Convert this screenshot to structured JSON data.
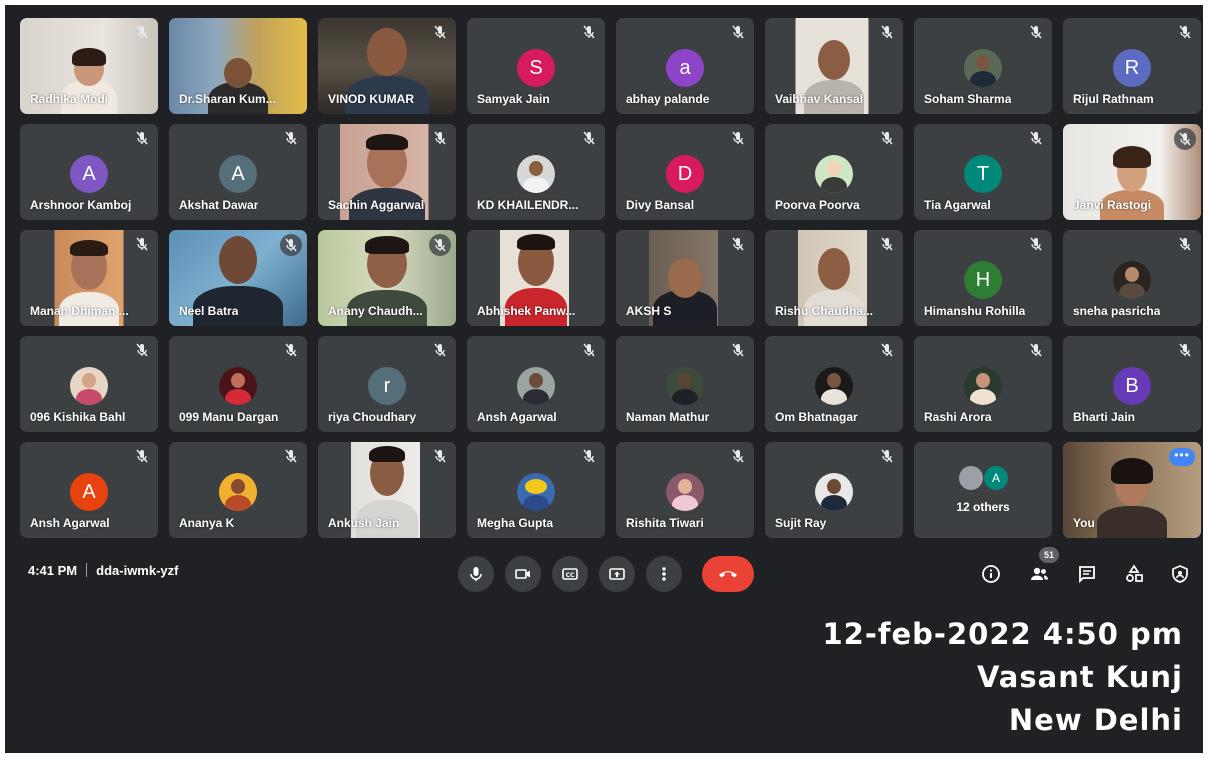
{
  "meeting": {
    "time": "4:41 PM",
    "code": "dda-iwmk-yzf",
    "participant_count": "51"
  },
  "participants": [
    {
      "name": "Radhika Modi"
    },
    {
      "name": "Dr.Sharan Kum..."
    },
    {
      "name": "VINOD KUMAR"
    },
    {
      "name": "Samyak Jain",
      "initial": "S",
      "color": "#d81b60"
    },
    {
      "name": "abhay palande",
      "initial": "a",
      "color": "#8e44c9"
    },
    {
      "name": "Vaibhav Kansal"
    },
    {
      "name": "Soham Sharma"
    },
    {
      "name": "Rijul Rathnam",
      "initial": "R",
      "color": "#5c6bc0"
    },
    {
      "name": "Arshnoor Kamboj",
      "initial": "A",
      "color": "#7e57c2"
    },
    {
      "name": "Akshat Dawar",
      "initial": "A",
      "color": "#546e7a"
    },
    {
      "name": "Sachin Aggarwal"
    },
    {
      "name": "KD KHAILENDR..."
    },
    {
      "name": "Divy Bansal",
      "initial": "D",
      "color": "#d81b60"
    },
    {
      "name": "Poorva Poorva"
    },
    {
      "name": "Tia Agarwal",
      "initial": "T",
      "color": "#00897b"
    },
    {
      "name": "Janvi Rastogi"
    },
    {
      "name": "Manan Dhiman ..."
    },
    {
      "name": "Neel Batra"
    },
    {
      "name": "Anany Chaudh..."
    },
    {
      "name": "Abhishek Panw..."
    },
    {
      "name": "AKSH S"
    },
    {
      "name": "Rishu Chaudha..."
    },
    {
      "name": "Himanshu Rohilla",
      "initial": "H",
      "color": "#2e7d32"
    },
    {
      "name": "sneha pasricha"
    },
    {
      "name": "096 Kishika Bahl"
    },
    {
      "name": "099 Manu Dargan"
    },
    {
      "name": "riya Choudhary",
      "initial": "r",
      "color": "#546e7a"
    },
    {
      "name": "Ansh Agarwal"
    },
    {
      "name": "Naman Mathur"
    },
    {
      "name": "Om Bhatnagar"
    },
    {
      "name": "Rashi Arora"
    },
    {
      "name": "Bharti Jain",
      "initial": "B",
      "color": "#673ab7"
    },
    {
      "name": "Ansh Agarwal",
      "initial": "A",
      "color": "#e8430f"
    },
    {
      "name": "Ananya K"
    },
    {
      "name": "Ankush Jain"
    },
    {
      "name": "Megha Gupta"
    },
    {
      "name": "Rishita Tiwari"
    },
    {
      "name": "Sujit Ray"
    }
  ],
  "others_tile": {
    "label": "12 others",
    "initial": "A",
    "color": "#00897b"
  },
  "self_tile": {
    "label": "You",
    "more_label": "•••"
  },
  "icons": {
    "mic_off": "mic-off-icon",
    "controls": [
      "mic-icon",
      "camera-icon",
      "captions-icon",
      "present-icon",
      "more-options-icon",
      "end-call-icon"
    ],
    "right": [
      "info-icon",
      "people-icon",
      "chat-icon",
      "activities-icon",
      "host-controls-icon"
    ]
  },
  "overlay": {
    "line1": "12-feb-2022 4:50 pm",
    "line2": "Vasant Kunj",
    "line3": "New Delhi"
  },
  "colors": {
    "background": "#202124",
    "tile": "#3c4043",
    "end_call": "#ea4335",
    "self_border": "#8ab4f8"
  }
}
